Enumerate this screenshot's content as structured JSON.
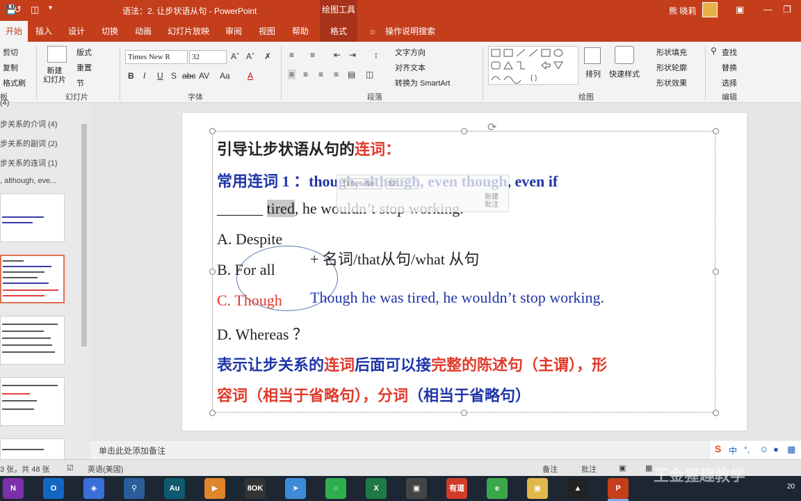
{
  "titlebar": {
    "title": "语法：2. 让步状语从句  -  PowerPoint",
    "context_tab_group": "绘图工具",
    "user": "熊 晓莉",
    "qa_icons": [
      "save-icon",
      "undo-icon",
      "redo-icon",
      "present-icon",
      "customize-icon"
    ]
  },
  "tabs": [
    "开始",
    "插入",
    "设计",
    "切换",
    "动画",
    "幻灯片放映",
    "审阅",
    "视图",
    "帮助",
    "格式",
    "操作说明搜索"
  ],
  "ribbon": {
    "clipboard": {
      "cut": "剪切",
      "copy": "复制",
      "format_painter": "格式刷",
      "label": "板"
    },
    "slides": {
      "new_slide": "新建\n幻灯片",
      "layout": "版式",
      "reset": "重置",
      "section": "节",
      "label": "幻灯片"
    },
    "font": {
      "font_name": "Times New R",
      "font_size": "32",
      "label": "字体"
    },
    "paragraph": {
      "text_direction": "文字方向",
      "align_text": "对齐文本",
      "smartart": "转换为 SmartArt",
      "label": "段落"
    },
    "drawing": {
      "arrange": "排列",
      "quick_styles": "快速样式",
      "shape_fill": "形状填充",
      "shape_outline": "形状轮廓",
      "shape_effects": "形状效果",
      "label": "绘图"
    },
    "editing": {
      "find": "查找",
      "replace": "替换",
      "select": "选择",
      "label": "编辑"
    }
  },
  "outline": {
    "items": [
      "(4)",
      "步关系的介词 (4)",
      "步关系的副词 (2)",
      "步关系的连词 (1)",
      ", although, eve..."
    ]
  },
  "slide": {
    "line1_a": "引导让步状语从句的",
    "line1_b": "连词：",
    "line2": "常用连词 1 ：though, although, even though, even if",
    "line3_blank": "______ ",
    "line3_tired": "tired",
    "line3_rest": ", he wouldn’t stop working.",
    "optA": "A. Despite",
    "optB": "B. For all",
    "note_ab": "+ 名词/that从句/what 从句",
    "optC": "C. Though",
    "answer": "Though he was tired, he wouldn’t stop working.",
    "optD": "D. Whereas ？",
    "rule1_a": "表示让步关系的",
    "rule1_b": "连词",
    "rule1_c": "后面可以接",
    "rule1_d": "完整的陈述句（主谓），形",
    "rule2_a": "容词（相当于省略句），",
    "rule2_b": "分词",
    "rule2_c": "（相当于省略句）",
    "minitool_font": "Times Ne",
    "minitool_size": "32",
    "minitool_comment": "新建\n批注"
  },
  "notes": {
    "placeholder": "单击此处添加备注"
  },
  "status": {
    "slide_count": "3 张，共 48 张",
    "language": "英语(美国)",
    "notes_btn": "备注",
    "comments_btn": "批注"
  },
  "taskbar": {
    "apps": [
      "OneNote",
      "Outlook",
      "Photos",
      "Search",
      "Audition",
      "Media",
      "BOOK",
      "Feishu",
      "WeChat",
      "Excel",
      "Camera",
      "有道",
      "Browser",
      "Explorer",
      "Reader",
      "PowerPoint"
    ],
    "watermark": "王金猩趣教学",
    "clock": "20"
  },
  "colors": {
    "accent": "#c43e1c",
    "slide_blue": "#1f35a8",
    "slide_red": "#e03a2a"
  }
}
